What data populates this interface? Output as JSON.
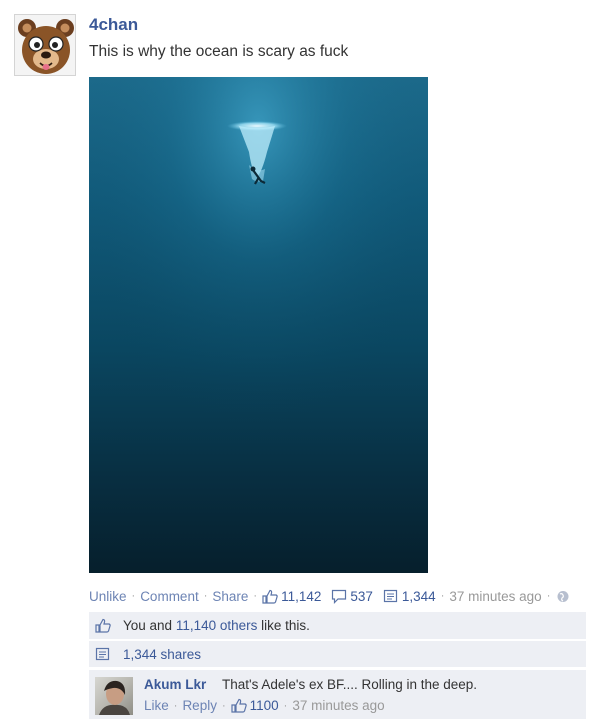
{
  "post": {
    "author": "4chan",
    "text": "This is why the ocean is scary as fuck",
    "image_alt": "deep ocean scene with a small diver near the surface"
  },
  "actions": {
    "unlike": "Unlike",
    "comment": "Comment",
    "share": "Share",
    "separator": "·",
    "like_count": "11,142",
    "comment_count": "537",
    "share_count": "1,344",
    "timestamp": "37 minutes ago"
  },
  "likes_summary": {
    "prefix": "You and ",
    "others_link": "11,140 others",
    "suffix": " like this."
  },
  "shares_summary": {
    "text": "1,344 shares"
  },
  "comment": {
    "author": "Akum Lkr",
    "text": "That's Adele's ex BF.... Rolling in the deep.",
    "like_label": "Like",
    "reply_label": "Reply",
    "like_count": "1100",
    "timestamp": "37 minutes ago"
  },
  "colors": {
    "link_blue": "#3b5998",
    "action_blue": "#6d84b4",
    "box_bg": "#edeff4",
    "muted": "#999999"
  }
}
